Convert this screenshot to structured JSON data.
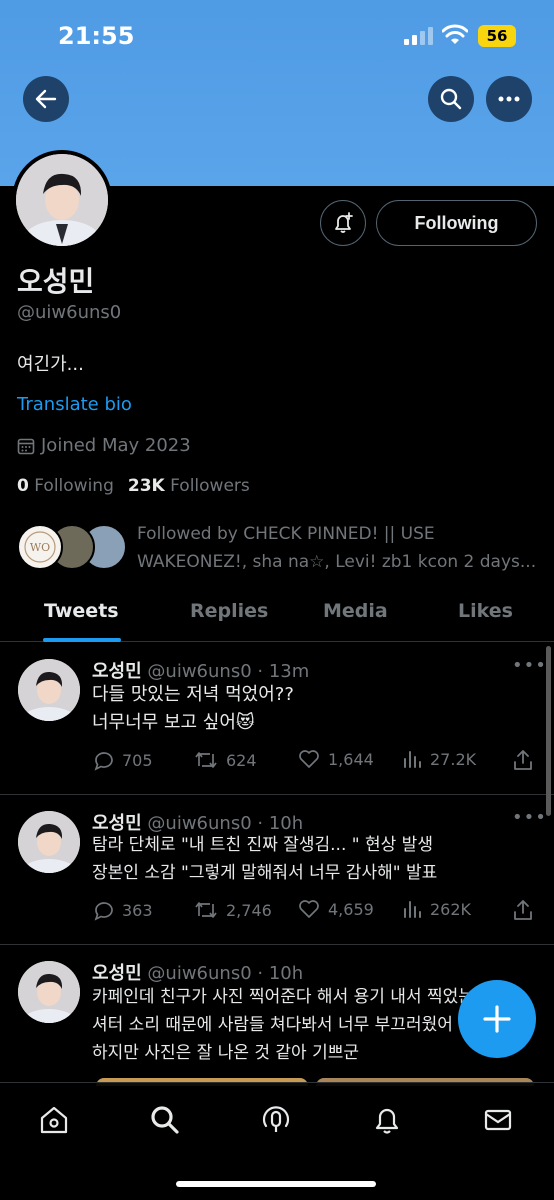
{
  "status": {
    "time": "21:55",
    "battery": "56"
  },
  "profile": {
    "display_name": "오성민",
    "handle": "@uiw6uns0",
    "bio": "여긴가...",
    "translate_label": "Translate bio",
    "joined": "Joined May 2023",
    "following_count": "0",
    "following_label": "Following",
    "followers_count": "23K",
    "followers_label": "Followers",
    "following_button": "Following",
    "followed_by_line1": "Followed by CHECK PINNED! || USE",
    "followed_by_line2": "WAKEONEZ!, sha na☆, Levi! zb1 kcon 2 days..."
  },
  "tabs": [
    {
      "label": "Tweets"
    },
    {
      "label": "Replies"
    },
    {
      "label": "Media"
    },
    {
      "label": "Likes"
    }
  ],
  "tweets": [
    {
      "name": "오성민",
      "meta": "@uiw6uns0 · 13m",
      "lines": [
        "다들 맛있는 저녁 먹었어??",
        "너무너무 보고 싶어😻"
      ],
      "replies": "705",
      "retweets": "624",
      "likes": "1,644",
      "views": "27.2K"
    },
    {
      "name": "오성민",
      "meta": "@uiw6uns0 · 10h",
      "lines": [
        "탐라 단체로 \"내 트친 진짜 잘생김... \" 현상 발생",
        "장본인 소감 \"그렇게 말해줘서 너무 감사해\" 발표"
      ],
      "replies": "363",
      "retweets": "2,746",
      "likes": "4,659",
      "views": "262K"
    },
    {
      "name": "오성민",
      "meta": "@uiw6uns0 · 10h",
      "lines": [
        "카페인데 친구가 사진 찍어준다 해서 용기 내서 찍었는데",
        "셔터 소리 때문에 사람들 쳐다봐서 너무 부끄러웠어",
        "하지만 사진은 잘 나온 것 같아 기쁘군"
      ]
    }
  ],
  "icons": {
    "back": "arrow-left-icon",
    "search": "search-icon",
    "more": "more-icon",
    "bell": "bell-plus-icon",
    "calendar": "calendar-icon",
    "nav": [
      "home-icon",
      "search-icon",
      "spaces-icon",
      "notifications-icon",
      "messages-icon"
    ]
  },
  "colors": {
    "accent": "#1d9bf0",
    "banner": "#5aa4ea",
    "muted": "#71767b"
  }
}
